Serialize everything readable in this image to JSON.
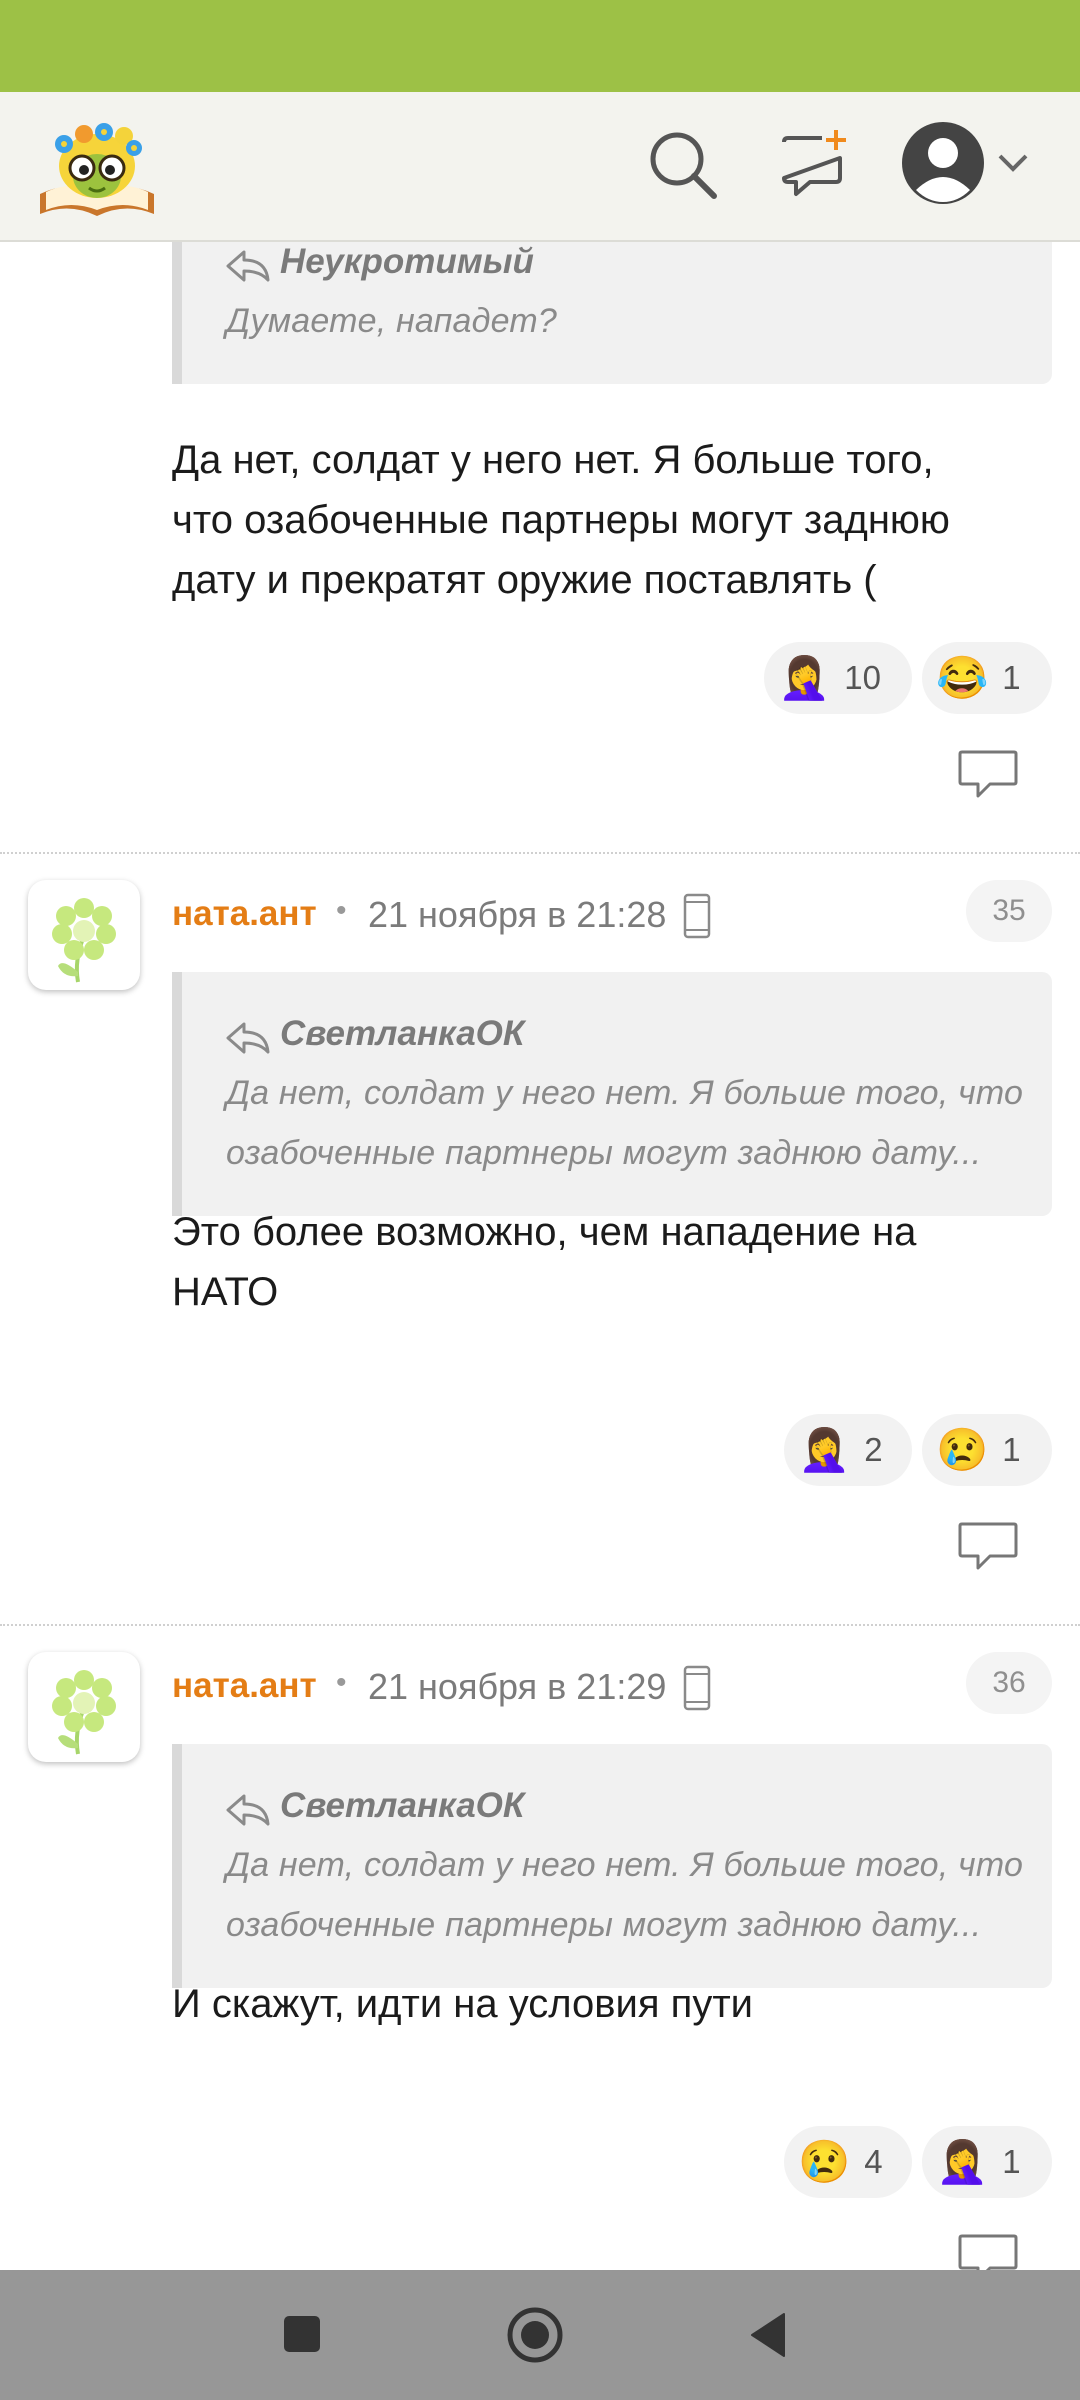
{
  "colors": {
    "status_bar": "#9dc146",
    "header_bg": "#f3f3ee",
    "author": "#e47d15",
    "nav_bar": "#979797"
  },
  "header": {
    "logo": "smiley-book-logo",
    "icons": [
      "search-icon",
      "compose-message-icon",
      "profile-avatar-icon",
      "chevron-down-icon"
    ]
  },
  "comments": [
    {
      "quote": {
        "author": "Неукротимый",
        "lines": [
          "Думаете, нападет?"
        ]
      },
      "text_lines": [
        "Да нет, солдат у него нет. Я больше того,",
        "что озабоченные партнеры могут заднюю",
        "дату и прекратят оружие поставлять ("
      ],
      "reactions": [
        {
          "emoji": "🤦‍♀️",
          "count": "10"
        },
        {
          "emoji": "😂",
          "count": "1"
        }
      ]
    },
    {
      "author": "ната.ант",
      "separator": "•",
      "date": "21 ноября в 21:28",
      "number": "35",
      "quote": {
        "author": "СветланкаОК",
        "lines": [
          "Да нет, солдат у него нет. Я больше того, что",
          "озабоченные партнеры могут заднюю дату..."
        ]
      },
      "text_lines": [
        "Это более возможно, чем нападение на",
        "НАТО"
      ],
      "reactions": [
        {
          "emoji": "🤦‍♀️",
          "count": "2"
        },
        {
          "emoji": "😢",
          "count": "1"
        }
      ]
    },
    {
      "author": "ната.ант",
      "separator": "•",
      "date": "21 ноября в 21:29",
      "number": "36",
      "quote": {
        "author": "СветланкаОК",
        "lines": [
          "Да нет, солдат у него нет. Я больше того, что",
          "озабоченные партнеры могут заднюю дату..."
        ]
      },
      "text_lines": [
        "И скажут, идти на условия пути"
      ],
      "reactions": [
        {
          "emoji": "😢",
          "count": "4"
        },
        {
          "emoji": "🤦‍♀️",
          "count": "1"
        }
      ]
    }
  ],
  "nav": {
    "buttons": [
      "recents-square-icon",
      "home-circle-icon",
      "back-triangle-icon"
    ]
  }
}
